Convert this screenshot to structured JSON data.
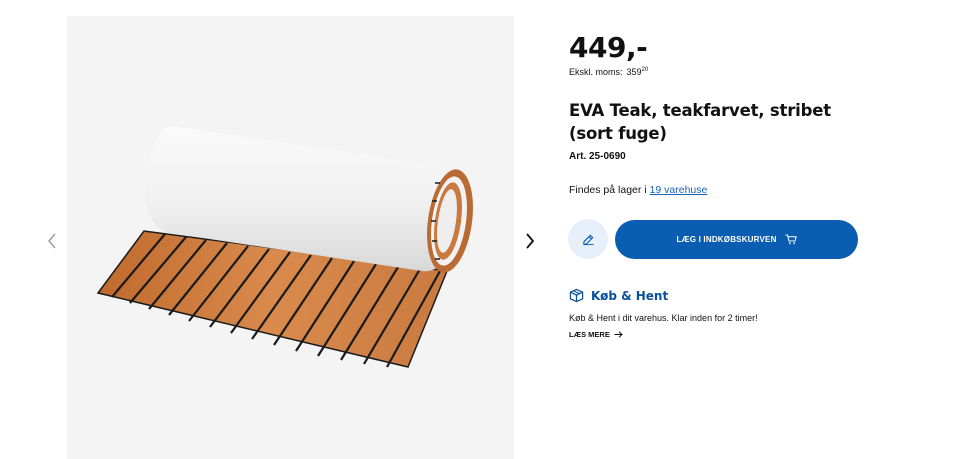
{
  "product": {
    "price": "449,-",
    "excl_vat_label": "Ekskl. moms:",
    "excl_vat_amount": "359",
    "excl_vat_cents": "20",
    "title": "EVA Teak, teakfarvet, stribet (sort fuge)",
    "article_number": "Art. 25-0690",
    "stock_text": "Findes på lager i ",
    "stock_link": "19 varehuse"
  },
  "actions": {
    "edit_icon": "pencil-icon",
    "add_to_cart_label": "LÆG I INDKØBSKURVEN",
    "cart_icon": "cart-icon"
  },
  "pickup": {
    "title": "Køb & Hent",
    "description": "Køb & Hent i dit varehus. Klar inden for 2 timer!",
    "read_more_label": "LÆS MERE",
    "icon": "box-icon"
  },
  "gallery": {
    "prev_icon": "chevron-left-icon",
    "next_icon": "chevron-right-icon"
  },
  "colors": {
    "primary": "#0a5db1",
    "accent_text": "#0a4f9c",
    "link": "#1a63b8",
    "edit_bg": "#e7f0fa",
    "gallery_bg": "#f4f4f4",
    "teak": "#c9793e"
  }
}
